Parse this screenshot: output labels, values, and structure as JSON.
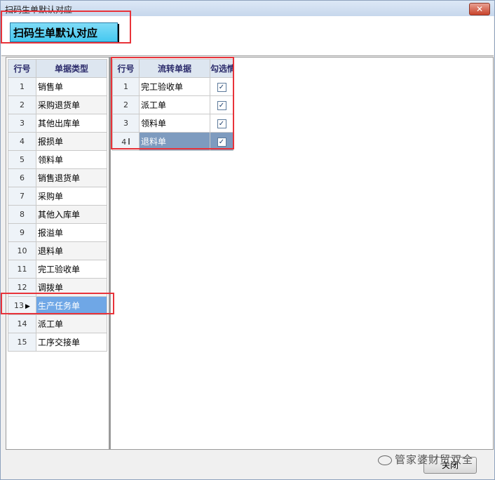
{
  "window": {
    "title": "扫码生单默认对应",
    "close_label": "✕"
  },
  "header": {
    "button_label": "扫码生单默认对应"
  },
  "left_table": {
    "headers": [
      "行号",
      "单据类型"
    ],
    "selected_row": 13,
    "rows": [
      {
        "no": "1",
        "type": "销售单"
      },
      {
        "no": "2",
        "type": "采购退货单"
      },
      {
        "no": "3",
        "type": "其他出库单"
      },
      {
        "no": "4",
        "type": "报损单"
      },
      {
        "no": "5",
        "type": "领料单"
      },
      {
        "no": "6",
        "type": "销售退货单"
      },
      {
        "no": "7",
        "type": "采购单"
      },
      {
        "no": "8",
        "type": "其他入库单"
      },
      {
        "no": "9",
        "type": "报溢单"
      },
      {
        "no": "10",
        "type": "退料单"
      },
      {
        "no": "11",
        "type": "完工验收单"
      },
      {
        "no": "12",
        "type": "调拨单"
      },
      {
        "no": "13",
        "type": "生产任务单"
      },
      {
        "no": "14",
        "type": "派工单"
      },
      {
        "no": "15",
        "type": "工序交接单"
      }
    ]
  },
  "right_table": {
    "headers": [
      "行号",
      "流转单据",
      "勾选情"
    ],
    "selected_row": 4,
    "rows": [
      {
        "no": "1",
        "doc": "完工验收单",
        "checked": true
      },
      {
        "no": "2",
        "doc": "派工单",
        "checked": true
      },
      {
        "no": "3",
        "doc": "领料单",
        "checked": true
      },
      {
        "no": "4",
        "doc": "退料单",
        "checked": true
      }
    ]
  },
  "footer": {
    "close_button": "关闭"
  },
  "watermark": {
    "text": "管家婆财贸双全"
  }
}
